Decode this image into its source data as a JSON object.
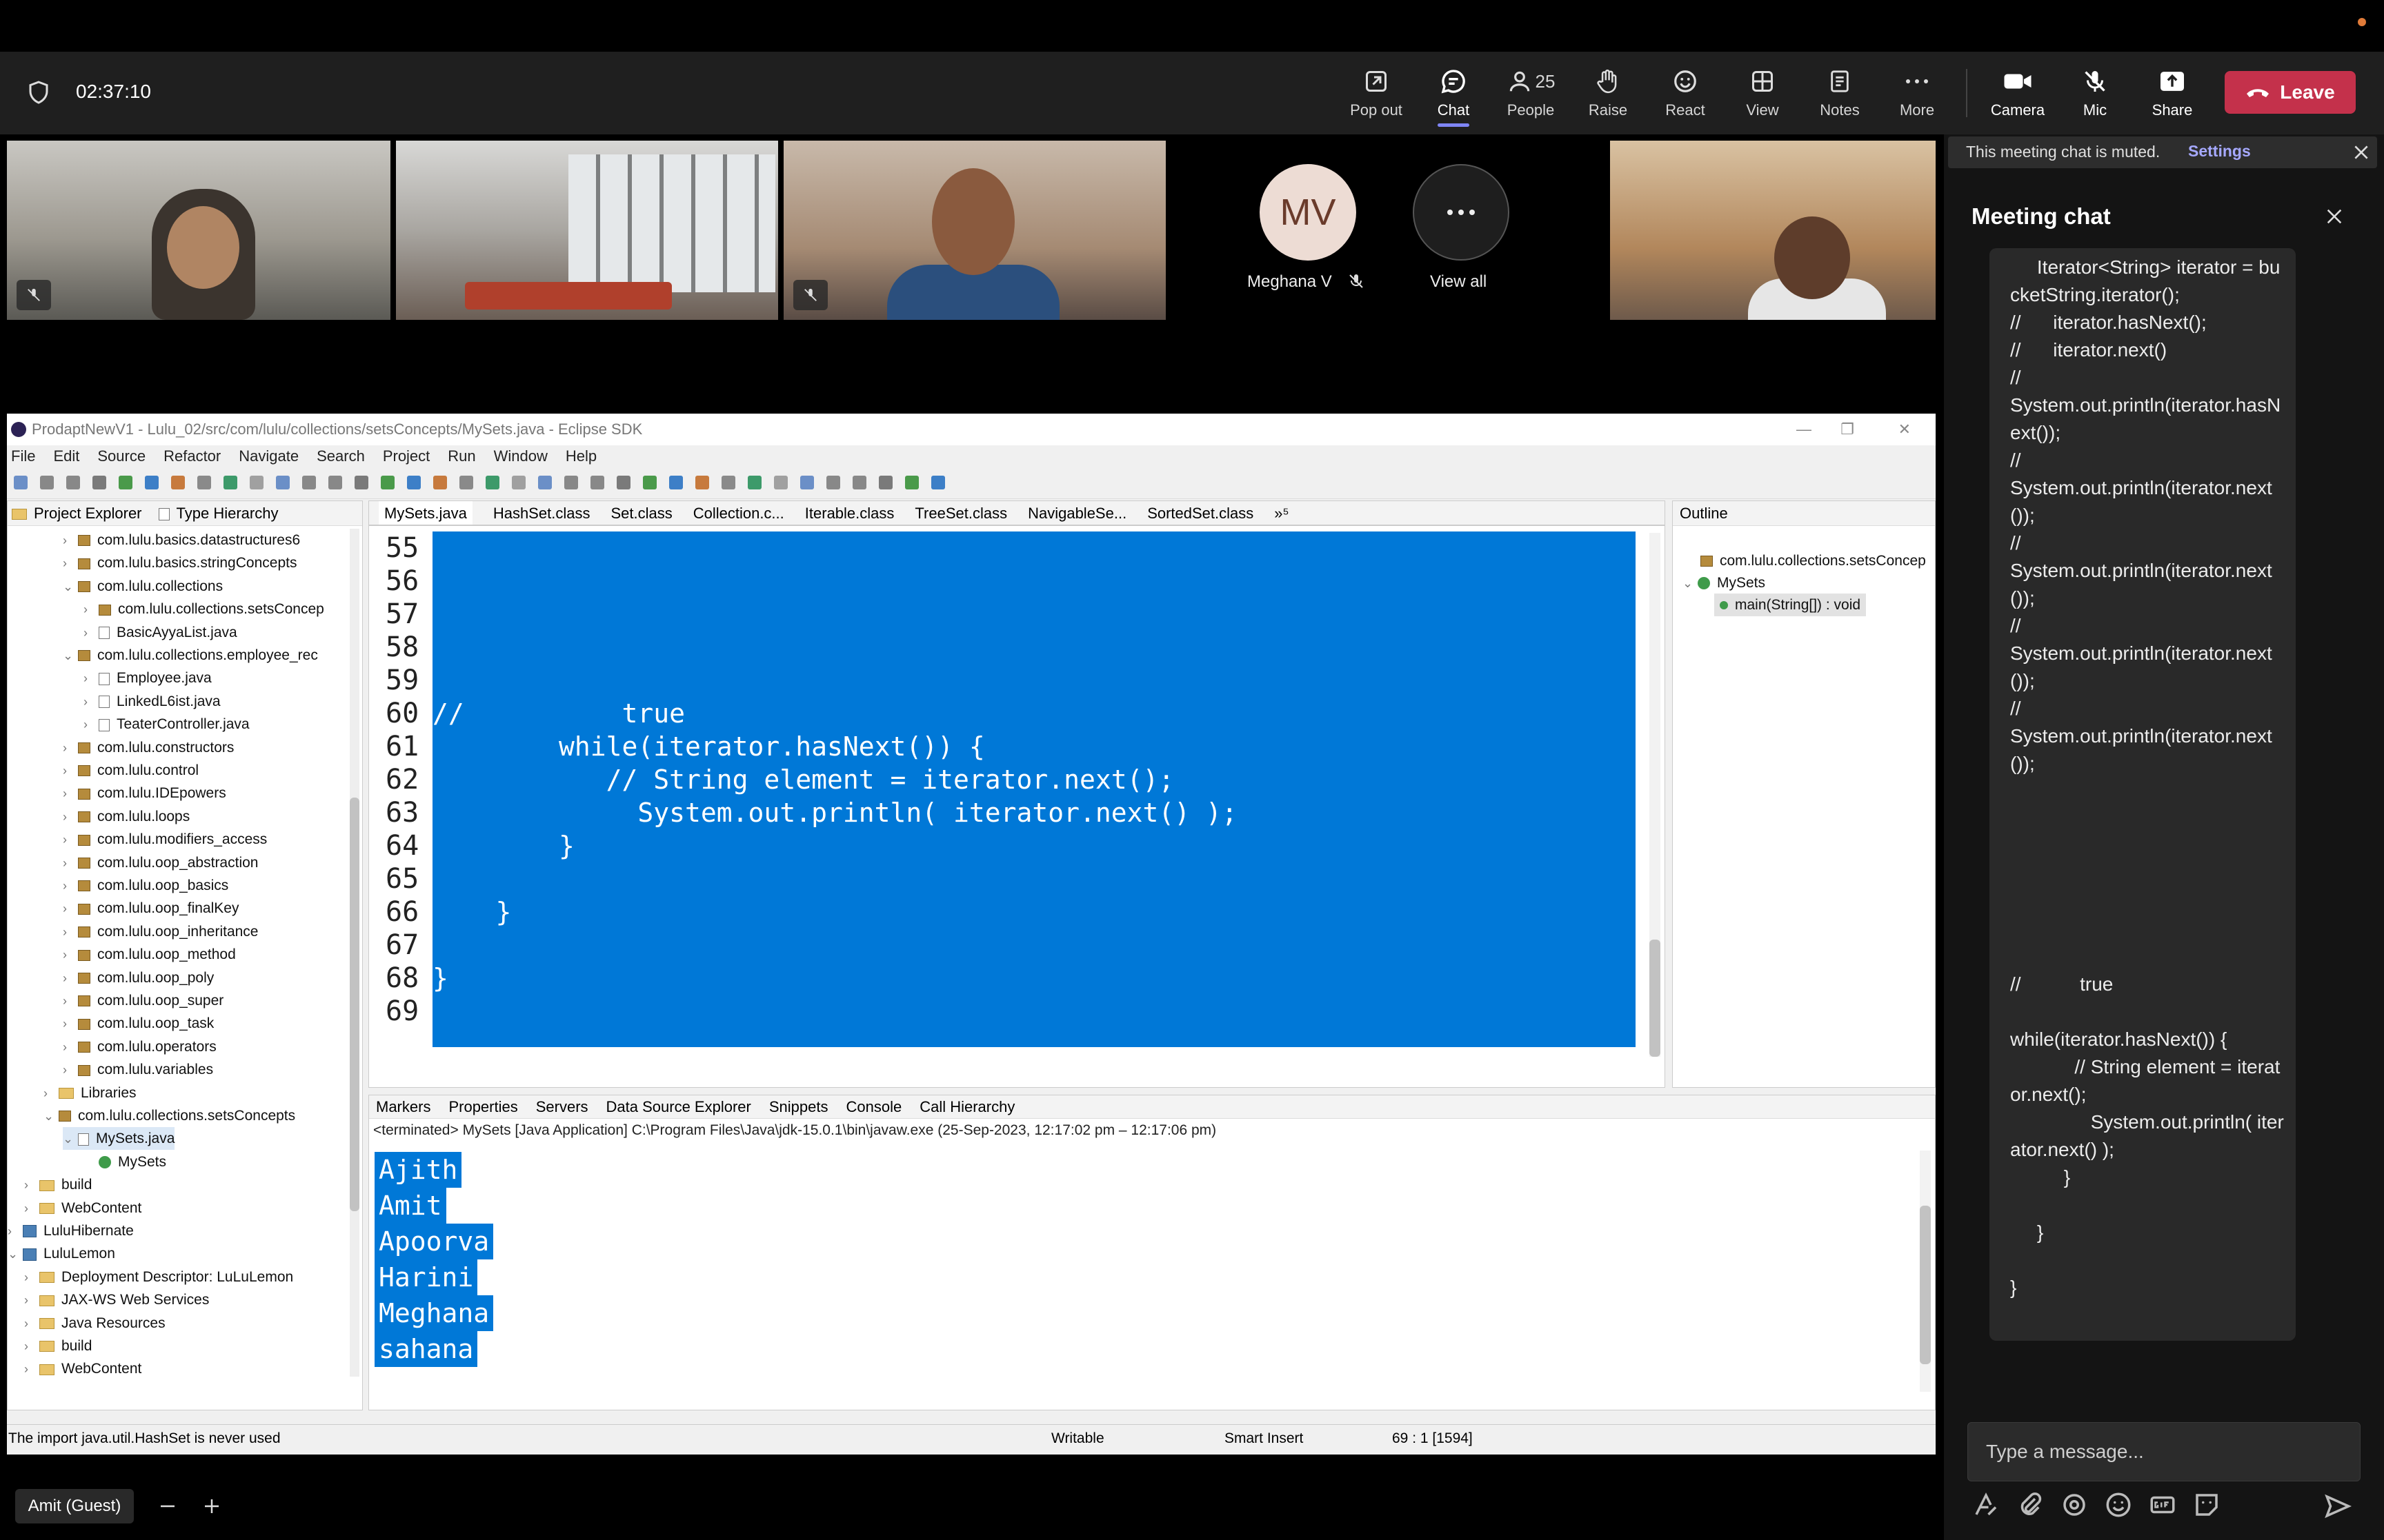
{
  "teams": {
    "timer": "02:37:10",
    "toolbar": {
      "pop_out": "Pop out",
      "chat": "Chat",
      "people_count": "25",
      "people": "People",
      "raise": "Raise",
      "react": "React",
      "view": "View",
      "notes": "Notes",
      "more": "More",
      "camera": "Camera",
      "mic": "Mic",
      "share": "Share",
      "leave": "Leave"
    },
    "participants": {
      "initials": "MV",
      "name": "Meghana V",
      "view_all": "View all"
    },
    "self_label": "Amit (Guest)"
  },
  "chat": {
    "muted_notice": "This meeting chat is muted.",
    "settings_link": "Settings",
    "title": "Meeting chat",
    "message": "     Iterator<String> iterator = bucketString.iterator();\n//      iterator.hasNext();\n//      iterator.next()\n//\nSystem.out.println(iterator.hasNext());\n//\nSystem.out.println(iterator.next());\n//\nSystem.out.println(iterator.next());\n//\nSystem.out.println(iterator.next());\n//\nSystem.out.println(iterator.next());\n\n\n\n\n\n\n\n//           true\n\nwhile(iterator.hasNext()) {\n            // String element = iterator.next();\n               System.out.println( iterator.next() );\n          }\n\n     }\n\n}",
    "input_placeholder": "Type a message..."
  },
  "eclipse": {
    "title": "ProdaptNewV1 - Lulu_02/src/com/lulu/collections/setsConcepts/MySets.java - Eclipse SDK",
    "menu": [
      "File",
      "Edit",
      "Source",
      "Refactor",
      "Navigate",
      "Search",
      "Project",
      "Run",
      "Window",
      "Help"
    ],
    "explorer_tabs": [
      "Project Explorer",
      "Type Hierarchy"
    ],
    "tree": [
      {
        "label": "com.lulu.basics.datastructures6",
        "icon": "package"
      },
      {
        "label": "com.lulu.basics.stringConcepts",
        "icon": "package"
      },
      {
        "label": "com.lulu.collections",
        "icon": "package"
      },
      {
        "label": "com.lulu.collections.setsConcep",
        "icon": "package"
      },
      {
        "label": "BasicAyyaList.java",
        "icon": "java-file"
      },
      {
        "label": "com.lulu.collections.employee_rec",
        "icon": "package"
      },
      {
        "label": "Employee.java",
        "icon": "java-file"
      },
      {
        "label": "LinkedL6ist.java",
        "icon": "java-file"
      },
      {
        "label": "TeaterController.java",
        "icon": "java-file"
      },
      {
        "label": "com.lulu.constructors",
        "icon": "package"
      },
      {
        "label": "com.lulu.control",
        "icon": "package"
      },
      {
        "label": "com.lulu.IDEpowers",
        "icon": "package"
      },
      {
        "label": "com.lulu.loops",
        "icon": "package"
      },
      {
        "label": "com.lulu.modifiers_access",
        "icon": "package"
      },
      {
        "label": "com.lulu.oop_abstraction",
        "icon": "package"
      },
      {
        "label": "com.lulu.oop_basics",
        "icon": "package"
      },
      {
        "label": "com.lulu.oop_finalKey",
        "icon": "package"
      },
      {
        "label": "com.lulu.oop_inheritance",
        "icon": "package"
      },
      {
        "label": "com.lulu.oop_method",
        "icon": "package"
      },
      {
        "label": "com.lulu.oop_poly",
        "icon": "package"
      },
      {
        "label": "com.lulu.oop_super",
        "icon": "package"
      },
      {
        "label": "com.lulu.oop_task",
        "icon": "package"
      },
      {
        "label": "com.lulu.operators",
        "icon": "package"
      },
      {
        "label": "com.lulu.variables",
        "icon": "package"
      },
      {
        "label": "Libraries",
        "icon": "folder"
      },
      {
        "label": "com.lulu.collections.setsConcepts",
        "icon": "package"
      },
      {
        "label": "MySets.java",
        "icon": "java-file"
      },
      {
        "label": "MySets",
        "icon": "class"
      },
      {
        "label": "build",
        "icon": "folder"
      },
      {
        "label": "WebContent",
        "icon": "folder"
      },
      {
        "label": "LuluHibernate",
        "icon": "project"
      },
      {
        "label": "LuluLemon",
        "icon": "project"
      },
      {
        "label": "Deployment Descriptor: LuLuLemon",
        "icon": "folder"
      },
      {
        "label": "JAX-WS Web Services",
        "icon": "folder"
      },
      {
        "label": "Java Resources",
        "icon": "folder"
      },
      {
        "label": "build",
        "icon": "folder"
      },
      {
        "label": "WebContent",
        "icon": "folder"
      }
    ],
    "editor_tabs": [
      "MySets.java",
      "HashSet.class",
      "Set.class",
      "Collection.c...",
      "Iterable.class",
      "TreeSet.class",
      "NavigableSe...",
      "SortedSet.class",
      "»⁵"
    ],
    "line_numbers": [
      "55",
      "56",
      "57",
      "58",
      "59",
      "60",
      "61",
      "62",
      "63",
      "64",
      "65",
      "66",
      "67",
      "68",
      "69"
    ],
    "code_lines": [
      "",
      "",
      "",
      "",
      "",
      "//          true",
      "        while(iterator.hasNext()) {",
      "           // String element = iterator.next();",
      "             System.out.println( iterator.next() );",
      "        }",
      "",
      "    }",
      "",
      "}",
      ""
    ],
    "outline": {
      "title": "Outline",
      "package": "com.lulu.collections.setsConcep",
      "class": "MySets",
      "method": "main(String[]) : void"
    },
    "console_tabs": [
      "Markers",
      "Properties",
      "Servers",
      "Data Source Explorer",
      "Snippets",
      "Console",
      "Call Hierarchy"
    ],
    "console_header": "<terminated> MySets [Java Application] C:\\Program Files\\Java\\jdk-15.0.1\\bin\\javaw.exe  (25-Sep-2023, 12:17:02 pm – 12:17:06 pm)",
    "console_output": [
      "Ajith",
      "Amit",
      "Apoorva",
      "Harini",
      "Meghana",
      "sahana"
    ],
    "status": {
      "message": "The import java.util.HashSet is never used",
      "writable": "Writable",
      "insert_mode": "Smart Insert",
      "position": "69 : 1 [1594]"
    }
  }
}
